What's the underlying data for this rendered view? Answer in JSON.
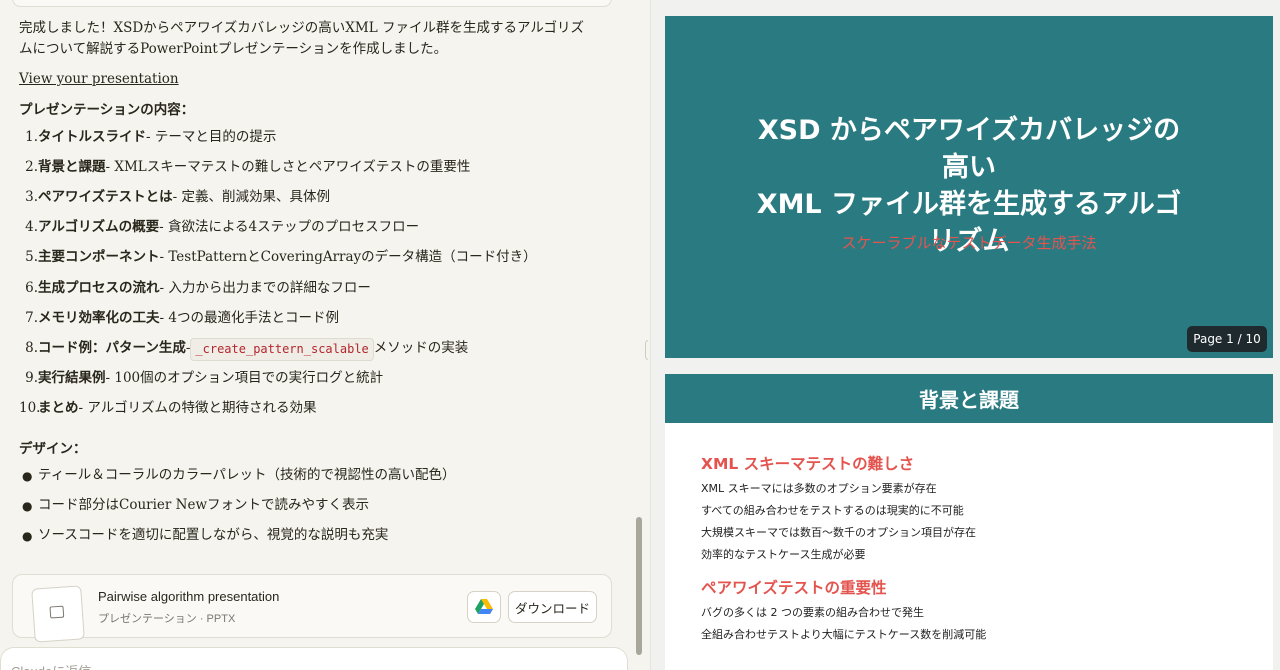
{
  "chat": {
    "intro": "完成しました！XSDからペアワイズカバレッジの高いXML ファイル群を生成するアルゴリズムについて解説するPowerPointプレゼンテーションを作成しました。",
    "link_label": "View your presentation",
    "contents_heading": "プレゼンテーションの内容：",
    "contents": [
      {
        "num": "1.",
        "title": "タイトルスライド",
        "desc": " - テーマと目的の提示"
      },
      {
        "num": "2.",
        "title": "背景と課題",
        "desc": " - XMLスキーマテストの難しさとペアワイズテストの重要性"
      },
      {
        "num": "3.",
        "title": "ペアワイズテストとは",
        "desc": " - 定義、削減効果、具体例"
      },
      {
        "num": "4.",
        "title": "アルゴリズムの概要",
        "desc": " - 貪欲法による4ステップのプロセスフロー"
      },
      {
        "num": "5.",
        "title": "主要コンポーネント",
        "desc": " - TestPatternとCoveringArrayのデータ構造（コード付き）"
      },
      {
        "num": "6.",
        "title": "生成プロセスの流れ",
        "desc": " - 入力から出力までの詳細なフロー"
      },
      {
        "num": "7.",
        "title": "メモリ効率化の工夫",
        "desc": " - 4つの最適化手法とコード例"
      },
      {
        "num": "8.",
        "title": "コード例：パターン生成",
        "desc_pre": " - ",
        "code": "_create_pattern_scalable",
        "desc": "メソッドの実装"
      },
      {
        "num": "9.",
        "title": "実行結果例",
        "desc": " - 100個のオプション項目での実行ログと統計"
      },
      {
        "num": "10.",
        "title": "まとめ",
        "desc": " - アルゴリズムの特徴と期待される効果"
      }
    ],
    "design_heading": "デザイン：",
    "design": [
      "ティール＆コーラルのカラーパレット（技術的で視認性の高い配色）",
      "コード部分はCourier Newフォントで読みやすく表示",
      "ソースコードを適切に配置しながら、視覚的な説明も充実"
    ],
    "file_card": {
      "title": "Pairwise algorithm presentation",
      "meta": "プレゼンテーション · PPTX",
      "download_label": "ダウンロード"
    },
    "reply_placeholder": "Claudeに返信"
  },
  "preview": {
    "slide1": {
      "title_lines": [
        "XSD からペアワイズカバレッジの",
        "高い",
        "XML ファイル群を生成するアルゴ",
        "リズム"
      ],
      "subtitle": "スケーラブルなテストデータ生成手法",
      "page_badge": "Page 1 / 10"
    },
    "slide2": {
      "header": "背景と課題",
      "section1_title": "XML スキーマテストの難しさ",
      "section1_bullets": [
        "XML スキーマには多数のオプション要素が存在",
        "すべての組み合わせをテストするのは現実的に不可能",
        "大規模スキーマでは数百〜数千のオプション項目が存在",
        "効率的なテストケース生成が必要"
      ],
      "section2_title": "ペアワイズテストの重要性",
      "section2_bullets": [
        "バグの多くは 2 つの要素の組み合わせで発生",
        "全組み合わせテストより大幅にテストケース数を削減可能"
      ]
    }
  },
  "colors": {
    "teal": "#2a7b81",
    "coral": "#e4544f",
    "code_red": "#b3272e"
  }
}
